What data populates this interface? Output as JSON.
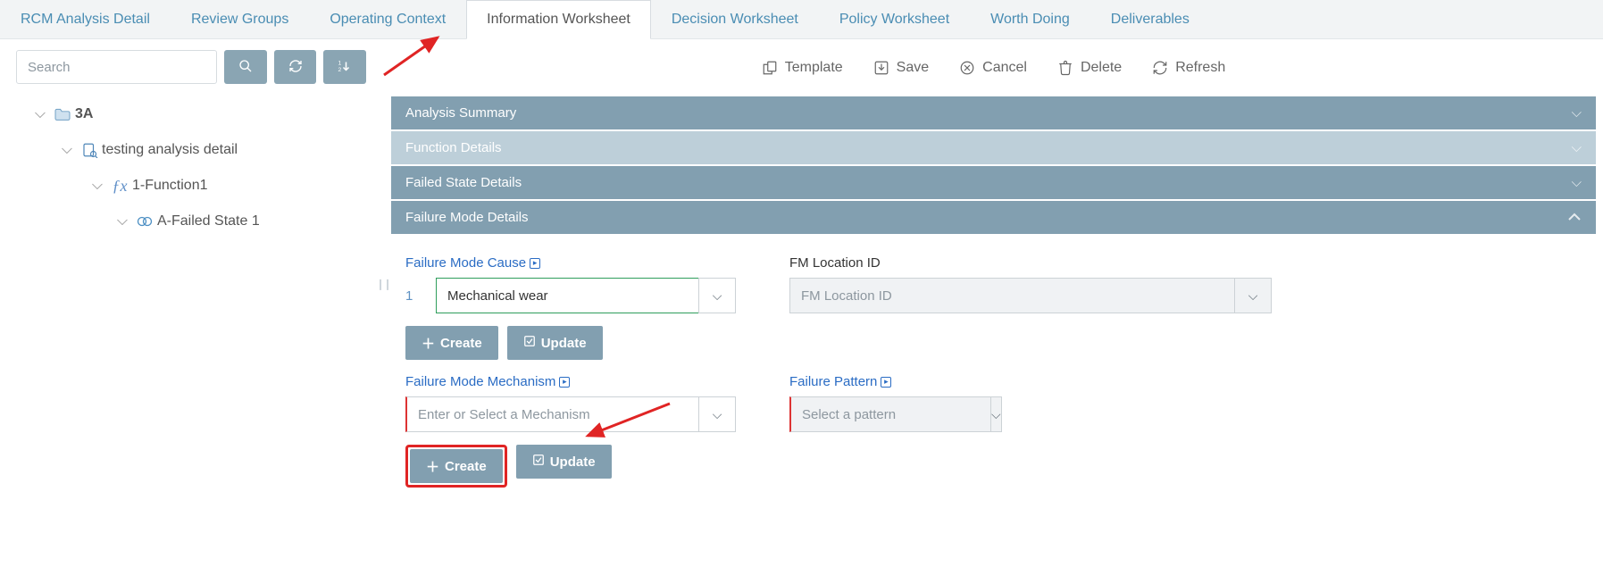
{
  "tabs": {
    "t0": "RCM Analysis Detail",
    "t1": "Review Groups",
    "t2": "Operating Context",
    "t3": "Information Worksheet",
    "t4": "Decision Worksheet",
    "t5": "Policy Worksheet",
    "t6": "Worth Doing",
    "t7": "Deliverables"
  },
  "sidebar": {
    "search_placeholder": "Search",
    "tree": {
      "n0": "3A",
      "n1": "testing analysis detail",
      "n2": "1-Function1",
      "n3": "A-Failed State 1"
    }
  },
  "toolbar": {
    "template": "Template",
    "save": "Save",
    "cancel": "Cancel",
    "delete": "Delete",
    "refresh": "Refresh"
  },
  "bars": {
    "b0": "Analysis Summary",
    "b1": "Function Details",
    "b2": "Failed State Details",
    "b3": "Failure Mode Details"
  },
  "form": {
    "cause_label": "Failure Mode Cause",
    "cause_num": "1",
    "cause_value": "Mechanical wear",
    "loc_label": "FM Location ID",
    "loc_placeholder": "FM Location ID",
    "mech_label": "Failure Mode Mechanism",
    "mech_placeholder": "Enter or Select a Mechanism",
    "pattern_label": "Failure Pattern",
    "pattern_placeholder": "Select a pattern",
    "create": "Create",
    "update": "Update"
  }
}
